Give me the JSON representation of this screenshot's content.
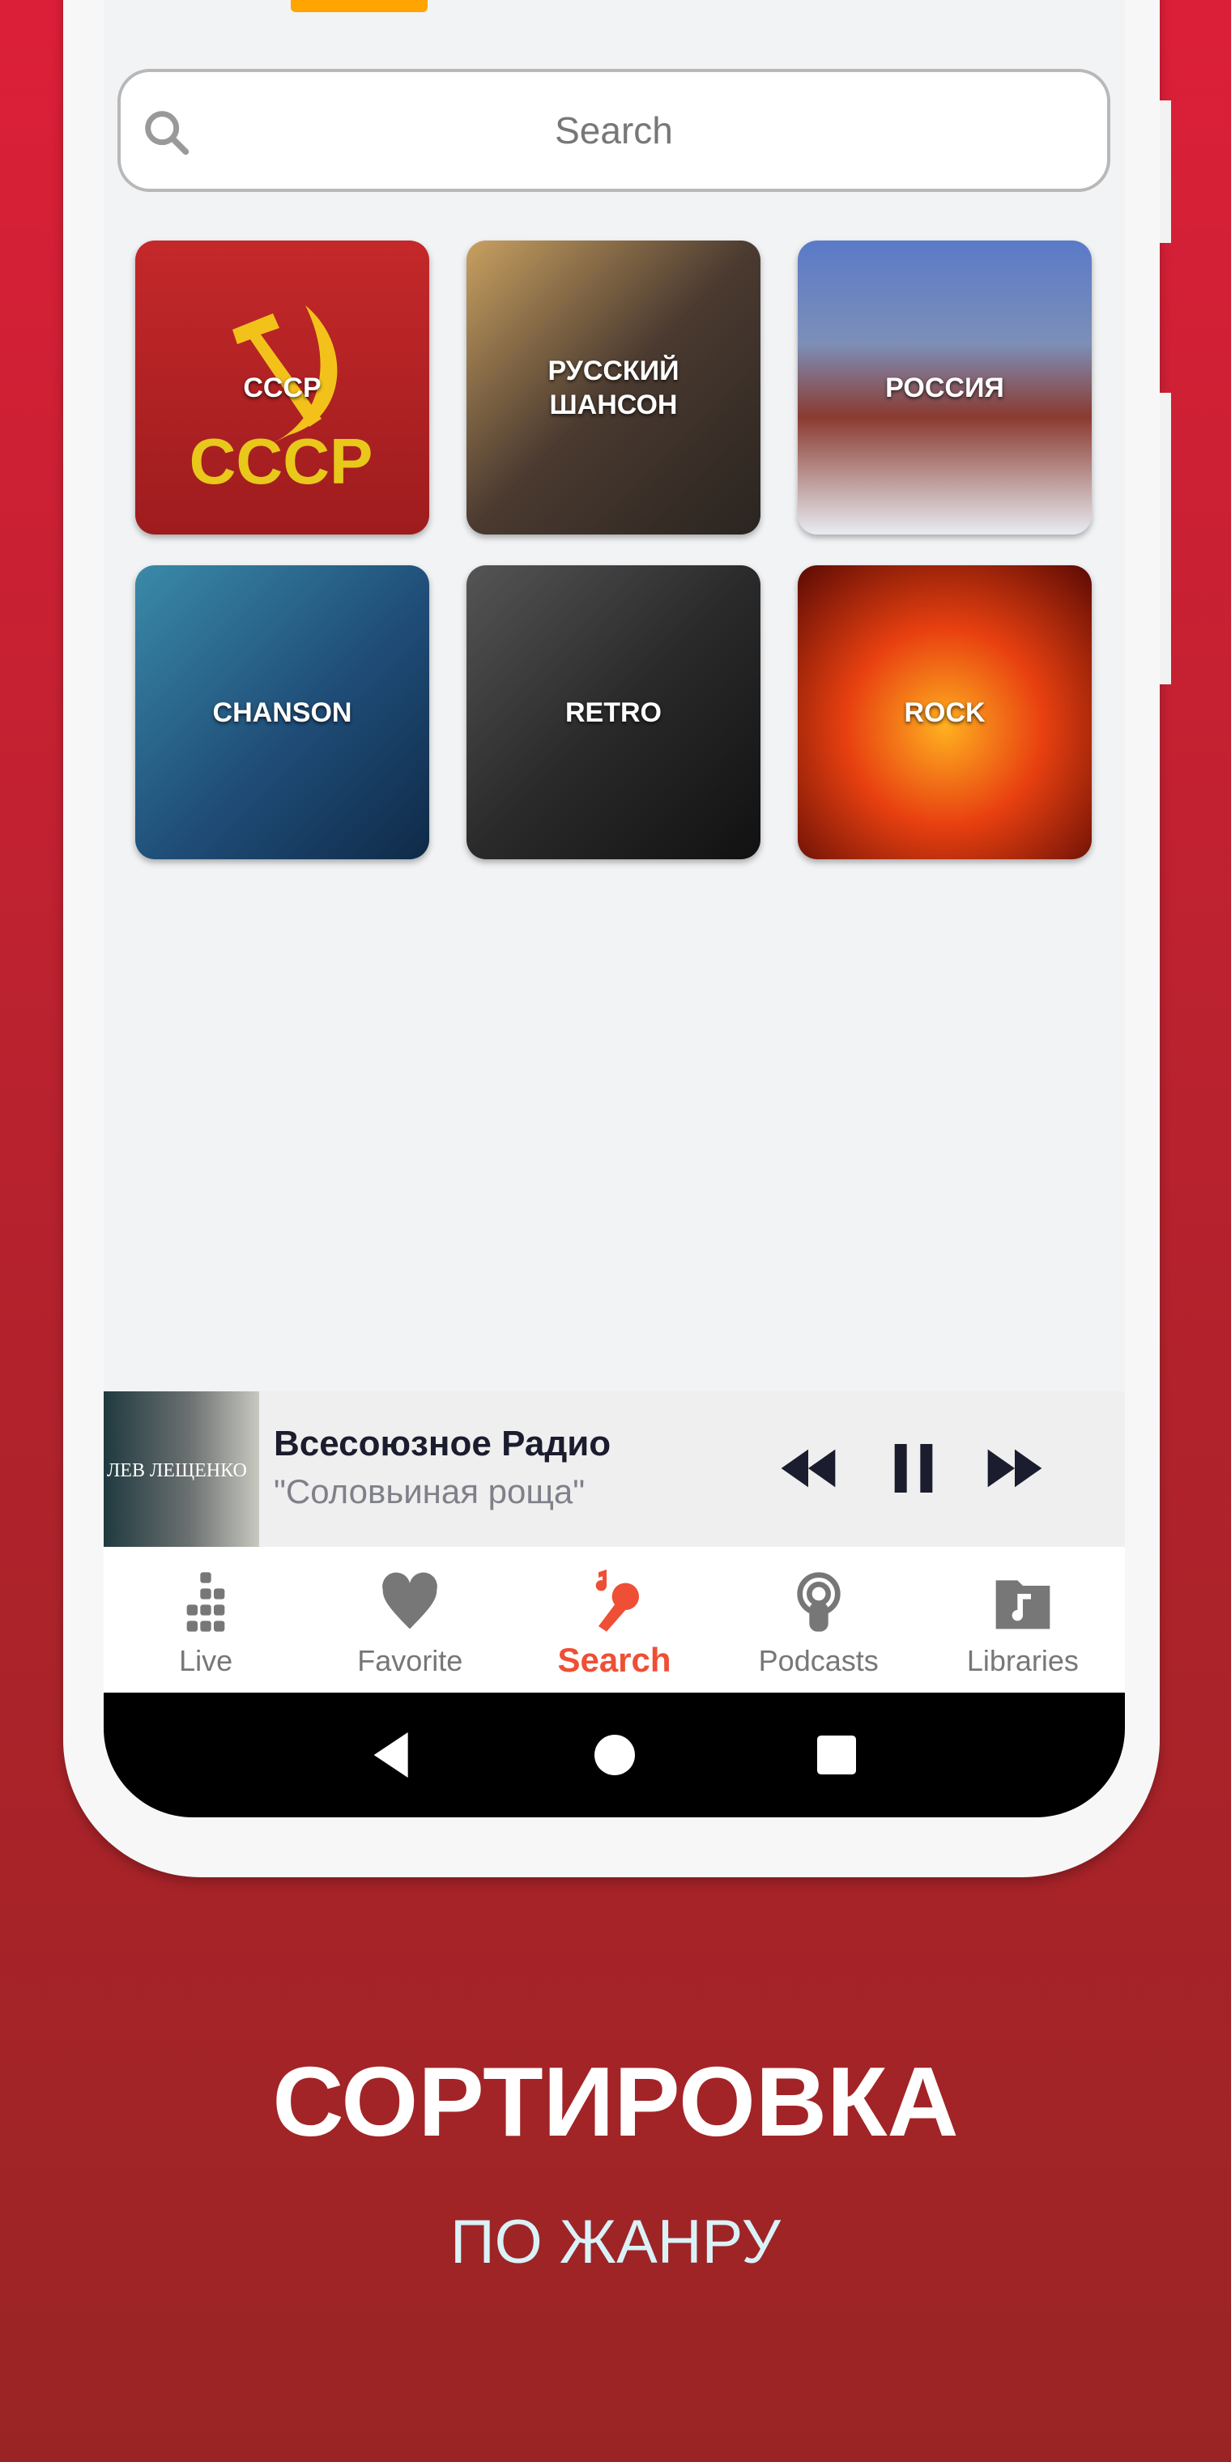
{
  "search": {
    "placeholder": "Search"
  },
  "genres": [
    {
      "label": "СССР"
    },
    {
      "label": "РУССКИЙ ШАНСОН"
    },
    {
      "label": "РОССИЯ"
    },
    {
      "label": "CHANSON"
    },
    {
      "label": "RETRO"
    },
    {
      "label": "ROCK"
    }
  ],
  "player": {
    "station": "Всесоюзное Радио",
    "track": "\"Соловьиная роща\"",
    "album_art_text": "ЛЕВ ЛЕЩЕНКО"
  },
  "tabs": [
    {
      "label": "Live",
      "icon": "equalizer-icon"
    },
    {
      "label": "Favorite",
      "icon": "heart-icon"
    },
    {
      "label": "Search",
      "icon": "microphone-icon",
      "active": true
    },
    {
      "label": "Podcasts",
      "icon": "podcast-icon"
    },
    {
      "label": "Libraries",
      "icon": "music-folder-icon"
    }
  ],
  "promo": {
    "title": "СОРТИРОВКА",
    "subtitle": "ПО ЖАНРУ"
  },
  "colors": {
    "accent": "#ee4f35",
    "tab_indicator": "#ffa400",
    "background_top": "#dc1f38",
    "background_bottom": "#9a2424"
  }
}
